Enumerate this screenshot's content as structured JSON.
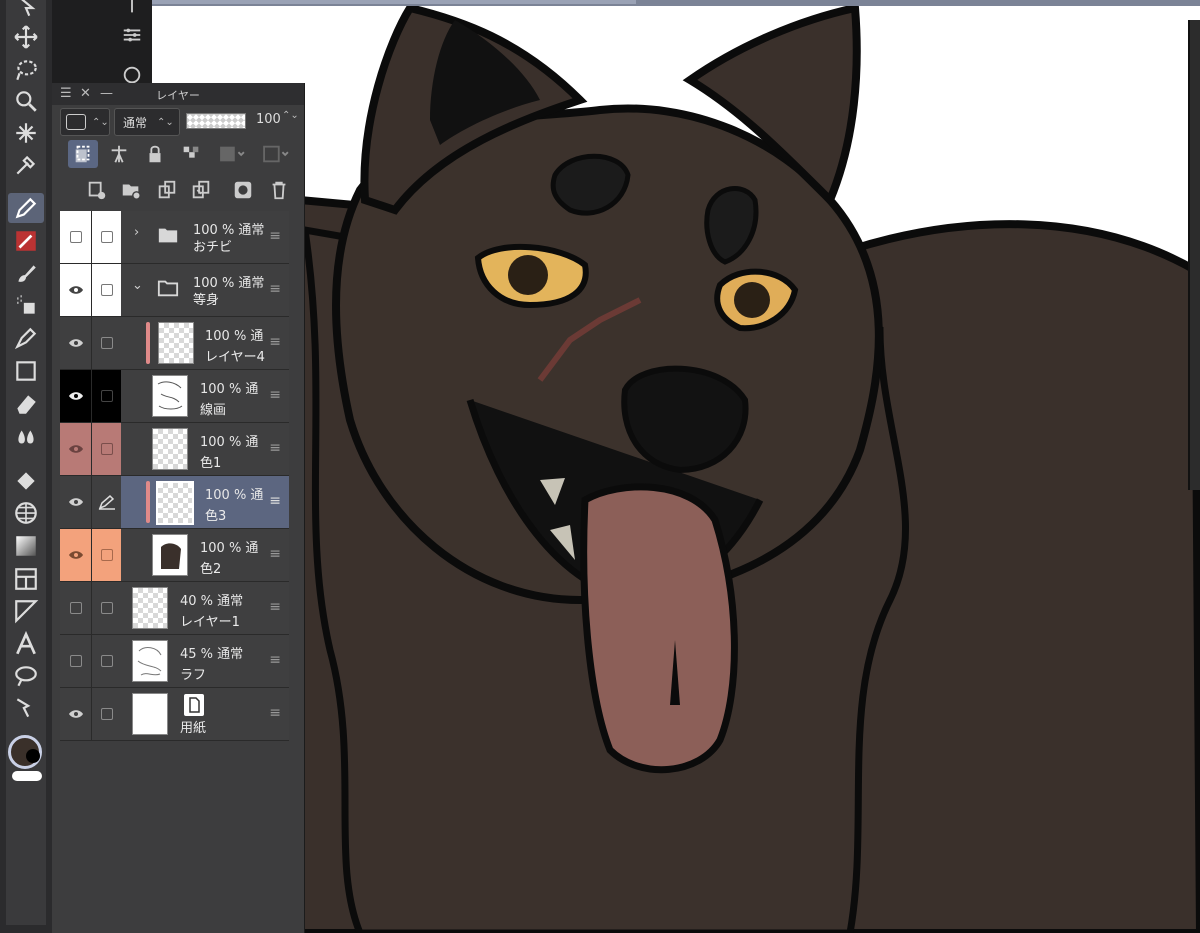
{
  "panel": {
    "title": "レイヤー",
    "blend_mode": "通常",
    "opacity": "100"
  },
  "layers": [
    {
      "opacity_mode": "100 % 通常",
      "name": "おチビ",
      "type": "folder",
      "collapsed": true,
      "visible": false
    },
    {
      "opacity_mode": "100 % 通常",
      "name": "等身",
      "type": "folder",
      "collapsed": false,
      "visible": true
    },
    {
      "opacity_mode": "100 % 通",
      "name": "レイヤー4",
      "type": "raster",
      "visible": true
    },
    {
      "opacity_mode": "100 % 通",
      "name": "線画",
      "type": "raster",
      "visible": true
    },
    {
      "opacity_mode": "100 % 通",
      "name": "色1",
      "type": "raster",
      "visible": true
    },
    {
      "opacity_mode": "100 % 通",
      "name": "色3",
      "type": "raster",
      "visible": true,
      "selected": true
    },
    {
      "opacity_mode": "100 % 通",
      "name": "色2",
      "type": "raster",
      "visible": true
    },
    {
      "opacity_mode": "40 % 通常",
      "name": "レイヤー1",
      "type": "raster",
      "visible": false
    },
    {
      "opacity_mode": "45 % 通常",
      "name": "ラフ",
      "type": "raster",
      "visible": false
    },
    {
      "opacity_mode": "",
      "name": "用紙",
      "type": "paper",
      "visible": true
    }
  ],
  "colors": {
    "main_color": "#3a302a",
    "sub_color": "#000000",
    "accent_selected": "#5c6680",
    "layer_color_tag": "#e08a89"
  }
}
